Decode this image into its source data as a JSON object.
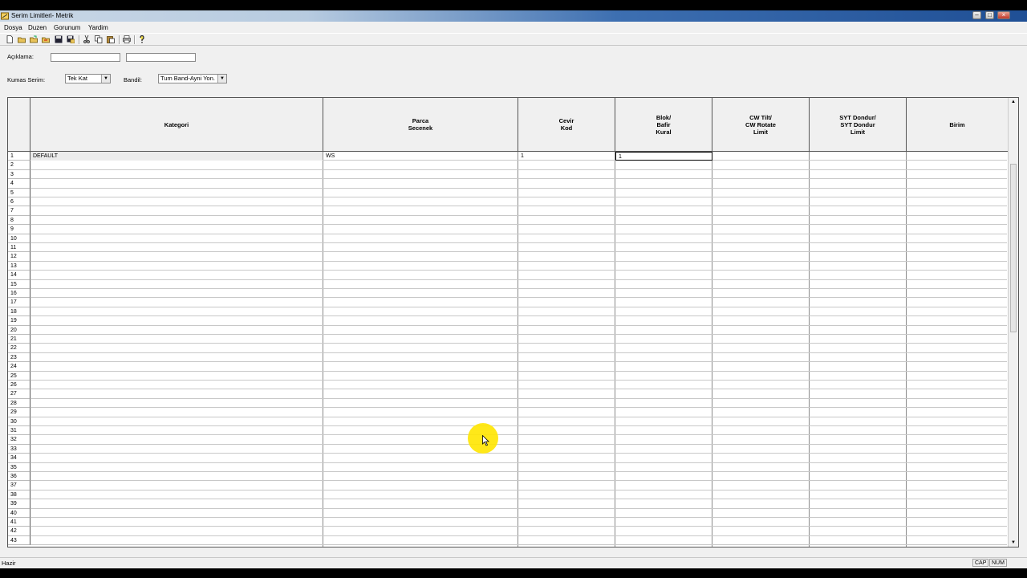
{
  "window": {
    "title": "Serim Limitleri-  Metrik"
  },
  "menu": {
    "items": [
      "Dosya",
      "Duzen",
      "Gorunum",
      "Yardim"
    ]
  },
  "toolbar": {
    "icons": [
      "new-icon",
      "open-icon",
      "open-folder-icon",
      "import-icon",
      "save-icon",
      "save-as-icon",
      "cut-icon",
      "copy-icon",
      "paste-icon",
      "print-icon",
      "help-icon"
    ]
  },
  "form": {
    "aciklama_label": "Açıklama:",
    "aciklama_value1": "",
    "aciklama_value2": "",
    "kumas_serim_label": "Kumas Serim:",
    "kumas_serim_value": "Tek Kat",
    "bandil_label": "Bandil:",
    "bandil_value": "Tum Band-Ayni Yon."
  },
  "grid": {
    "columns": [
      "Kategori",
      "Parca\nSecenek",
      "Cevir\nKod",
      "Blok/\nBafir\nKural",
      "CW Tilt/\nCW Rotate\nLimit",
      "SYT Dondur/\nSYT Dondur\nLimit",
      "Birim"
    ],
    "row_numbers": [
      "1",
      "2",
      "3",
      "4",
      "5",
      "6",
      "7",
      "8",
      "9",
      "10",
      "11",
      "12",
      "13",
      "14",
      "15",
      "16",
      "17",
      "18",
      "19",
      "20",
      "21",
      "22",
      "23",
      "24",
      "25",
      "26",
      "27",
      "28",
      "29",
      "30",
      "31",
      "32",
      "33",
      "34",
      "35",
      "36",
      "37",
      "38",
      "39",
      "40",
      "41",
      "42",
      "43"
    ],
    "rows": [
      [
        "DEFAULT",
        "WS",
        "1",
        "1",
        "",
        "",
        ""
      ]
    ]
  },
  "status": {
    "text": "Hazir",
    "cap": "CAP",
    "num": "NUM"
  }
}
